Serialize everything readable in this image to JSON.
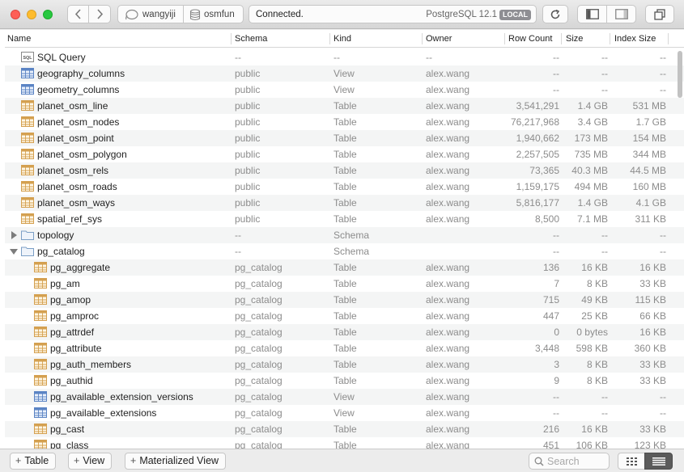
{
  "toolbar": {
    "user": "wangyiji",
    "database": "osmfun",
    "status": "Connected.",
    "server": "PostgreSQL 12.1",
    "badge": "LOCAL"
  },
  "columns": [
    "Name",
    "Schema",
    "Kind",
    "Owner",
    "Row Count",
    "Size",
    "Index Size"
  ],
  "rows": [
    {
      "name": "SQL Query",
      "schema": "--",
      "kind": "--",
      "owner": "--",
      "rows": "--",
      "size": "--",
      "index": "--",
      "icon": "sql-icon",
      "indent": 0
    },
    {
      "name": "geography_columns",
      "schema": "public",
      "kind": "View",
      "owner": "alex.wang",
      "rows": "--",
      "size": "--",
      "index": "--",
      "icon": "view-icon",
      "indent": 0
    },
    {
      "name": "geometry_columns",
      "schema": "public",
      "kind": "View",
      "owner": "alex.wang",
      "rows": "--",
      "size": "--",
      "index": "--",
      "icon": "view-icon",
      "indent": 0
    },
    {
      "name": "planet_osm_line",
      "schema": "public",
      "kind": "Table",
      "owner": "alex.wang",
      "rows": "3,541,291",
      "size": "1.4 GB",
      "index": "531 MB",
      "icon": "table-icon",
      "indent": 0
    },
    {
      "name": "planet_osm_nodes",
      "schema": "public",
      "kind": "Table",
      "owner": "alex.wang",
      "rows": "76,217,968",
      "size": "3.4 GB",
      "index": "1.7 GB",
      "icon": "table-icon",
      "indent": 0
    },
    {
      "name": "planet_osm_point",
      "schema": "public",
      "kind": "Table",
      "owner": "alex.wang",
      "rows": "1,940,662",
      "size": "173 MB",
      "index": "154 MB",
      "icon": "table-icon",
      "indent": 0
    },
    {
      "name": "planet_osm_polygon",
      "schema": "public",
      "kind": "Table",
      "owner": "alex.wang",
      "rows": "2,257,505",
      "size": "735 MB",
      "index": "344 MB",
      "icon": "table-icon",
      "indent": 0
    },
    {
      "name": "planet_osm_rels",
      "schema": "public",
      "kind": "Table",
      "owner": "alex.wang",
      "rows": "73,365",
      "size": "40.3 MB",
      "index": "44.5 MB",
      "icon": "table-icon",
      "indent": 0
    },
    {
      "name": "planet_osm_roads",
      "schema": "public",
      "kind": "Table",
      "owner": "alex.wang",
      "rows": "1,159,175",
      "size": "494 MB",
      "index": "160 MB",
      "icon": "table-icon",
      "indent": 0
    },
    {
      "name": "planet_osm_ways",
      "schema": "public",
      "kind": "Table",
      "owner": "alex.wang",
      "rows": "5,816,177",
      "size": "1.4 GB",
      "index": "4.1 GB",
      "icon": "table-icon",
      "indent": 0
    },
    {
      "name": "spatial_ref_sys",
      "schema": "public",
      "kind": "Table",
      "owner": "alex.wang",
      "rows": "8,500",
      "size": "7.1 MB",
      "index": "311 KB",
      "icon": "table-icon",
      "indent": 0
    },
    {
      "name": "topology",
      "schema": "--",
      "kind": "Schema",
      "owner": "",
      "rows": "--",
      "size": "--",
      "index": "--",
      "icon": "folder-icon",
      "indent": 0,
      "disclosure": "collapsed"
    },
    {
      "name": "pg_catalog",
      "schema": "--",
      "kind": "Schema",
      "owner": "",
      "rows": "--",
      "size": "--",
      "index": "--",
      "icon": "folder-icon",
      "indent": 0,
      "disclosure": "expanded"
    },
    {
      "name": "pg_aggregate",
      "schema": "pg_catalog",
      "kind": "Table",
      "owner": "alex.wang",
      "rows": "136",
      "size": "16 KB",
      "index": "16 KB",
      "icon": "table-icon",
      "indent": 1
    },
    {
      "name": "pg_am",
      "schema": "pg_catalog",
      "kind": "Table",
      "owner": "alex.wang",
      "rows": "7",
      "size": "8 KB",
      "index": "33 KB",
      "icon": "table-icon",
      "indent": 1
    },
    {
      "name": "pg_amop",
      "schema": "pg_catalog",
      "kind": "Table",
      "owner": "alex.wang",
      "rows": "715",
      "size": "49 KB",
      "index": "115 KB",
      "icon": "table-icon",
      "indent": 1
    },
    {
      "name": "pg_amproc",
      "schema": "pg_catalog",
      "kind": "Table",
      "owner": "alex.wang",
      "rows": "447",
      "size": "25 KB",
      "index": "66 KB",
      "icon": "table-icon",
      "indent": 1
    },
    {
      "name": "pg_attrdef",
      "schema": "pg_catalog",
      "kind": "Table",
      "owner": "alex.wang",
      "rows": "0",
      "size": "0 bytes",
      "index": "16 KB",
      "icon": "table-icon",
      "indent": 1
    },
    {
      "name": "pg_attribute",
      "schema": "pg_catalog",
      "kind": "Table",
      "owner": "alex.wang",
      "rows": "3,448",
      "size": "598 KB",
      "index": "360 KB",
      "icon": "table-icon",
      "indent": 1
    },
    {
      "name": "pg_auth_members",
      "schema": "pg_catalog",
      "kind": "Table",
      "owner": "alex.wang",
      "rows": "3",
      "size": "8 KB",
      "index": "33 KB",
      "icon": "table-icon",
      "indent": 1
    },
    {
      "name": "pg_authid",
      "schema": "pg_catalog",
      "kind": "Table",
      "owner": "alex.wang",
      "rows": "9",
      "size": "8 KB",
      "index": "33 KB",
      "icon": "table-icon",
      "indent": 1
    },
    {
      "name": "pg_available_extension_versions",
      "schema": "pg_catalog",
      "kind": "View",
      "owner": "alex.wang",
      "rows": "--",
      "size": "--",
      "index": "--",
      "icon": "view-icon",
      "indent": 1
    },
    {
      "name": "pg_available_extensions",
      "schema": "pg_catalog",
      "kind": "View",
      "owner": "alex.wang",
      "rows": "--",
      "size": "--",
      "index": "--",
      "icon": "view-icon",
      "indent": 1
    },
    {
      "name": "pg_cast",
      "schema": "pg_catalog",
      "kind": "Table",
      "owner": "alex.wang",
      "rows": "216",
      "size": "16 KB",
      "index": "33 KB",
      "icon": "table-icon",
      "indent": 1
    },
    {
      "name": "pg_class",
      "schema": "pg_catalog",
      "kind": "Table",
      "owner": "alex.wang",
      "rows": "451",
      "size": "106 KB",
      "index": "123 KB",
      "icon": "table-icon",
      "indent": 1
    }
  ],
  "bottom": {
    "add_table": "Table",
    "add_view": "View",
    "add_matview": "Materialized View",
    "search_placeholder": "Search"
  },
  "colors": {
    "table_icon": "#d4a050",
    "view_icon": "#5b84c4",
    "folder_icon": "#7c9fc6"
  }
}
